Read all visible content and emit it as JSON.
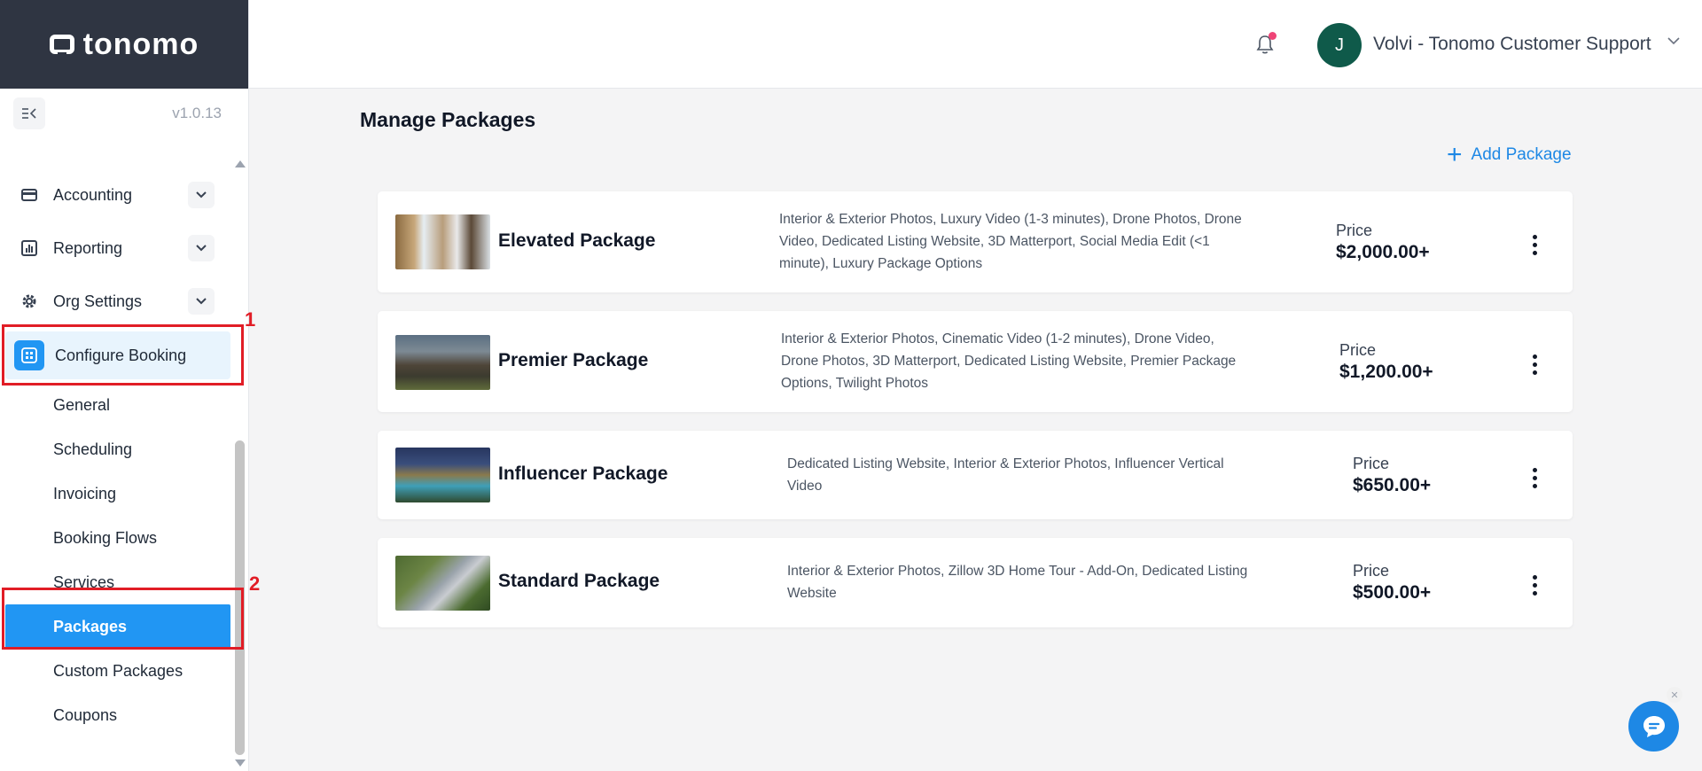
{
  "brand": {
    "name": "tonomo"
  },
  "sidebar": {
    "version": "v1.0.13",
    "collapse_icon": "collapse-sidebar-icon",
    "items": [
      {
        "label": "Accounting",
        "icon": "credit-card-icon"
      },
      {
        "label": "Reporting",
        "icon": "chart-icon"
      },
      {
        "label": "Org Settings",
        "icon": "gear-icon"
      },
      {
        "label": "Configure Booking",
        "icon": "booking-icon"
      }
    ],
    "sub_items": [
      {
        "label": "General"
      },
      {
        "label": "Scheduling"
      },
      {
        "label": "Invoicing"
      },
      {
        "label": "Booking Flows"
      },
      {
        "label": "Services"
      },
      {
        "label": "Packages"
      },
      {
        "label": "Custom Packages"
      },
      {
        "label": "Coupons"
      }
    ],
    "annotations": [
      "1",
      "2"
    ],
    "active_color": "#2196f3"
  },
  "header": {
    "avatar_initial": "J",
    "user_name": "Volvi - Tonomo Customer Support"
  },
  "main": {
    "title": "Manage Packages",
    "add_label": "Add Package",
    "price_label": "Price",
    "packages": [
      {
        "name": "Elevated Package",
        "description": "Interior & Exterior Photos, Luxury Video (1-3 minutes), Drone Photos, Drone Video, Dedicated Listing Website, 3D Matterport, Social Media Edit (<1 minute), Luxury Package Options",
        "price": "$2,000.00+"
      },
      {
        "name": "Premier Package",
        "description": "Interior & Exterior Photos, Cinematic Video (1-2 minutes), Drone Video, Drone Photos, 3D Matterport, Dedicated Listing Website, Premier Package Options, Twilight Photos",
        "price": "$1,200.00+"
      },
      {
        "name": "Influencer Package",
        "description": "Dedicated Listing Website, Interior & Exterior Photos, Influencer Vertical Video",
        "price": "$650.00+"
      },
      {
        "name": "Standard Package",
        "description": "Interior & Exterior Photos, Zillow 3D Home Tour - Add-On, Dedicated Listing Website",
        "price": "$500.00+"
      }
    ]
  }
}
